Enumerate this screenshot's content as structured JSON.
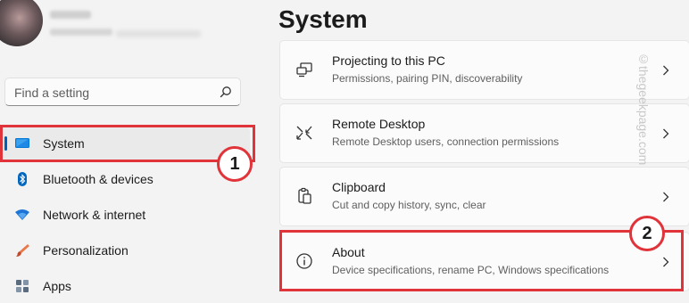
{
  "sidebar": {
    "search": {
      "placeholder": "Find a setting"
    },
    "items": [
      {
        "label": "System",
        "icon": "display-icon"
      },
      {
        "label": "Bluetooth & devices",
        "icon": "bluetooth-icon"
      },
      {
        "label": "Network & internet",
        "icon": "wifi-icon"
      },
      {
        "label": "Personalization",
        "icon": "brush-icon"
      },
      {
        "label": "Apps",
        "icon": "apps-icon"
      }
    ]
  },
  "main": {
    "title": "System",
    "cards": [
      {
        "title": "Projecting to this PC",
        "desc": "Permissions, pairing PIN, discoverability",
        "icon": "projector-icon"
      },
      {
        "title": "Remote Desktop",
        "desc": "Remote Desktop users, connection permissions",
        "icon": "remote-desktop-icon"
      },
      {
        "title": "Clipboard",
        "desc": "Cut and copy history, sync, clear",
        "icon": "clipboard-icon"
      },
      {
        "title": "About",
        "desc": "Device specifications, rename PC, Windows specifications",
        "icon": "info-icon"
      }
    ]
  },
  "annotations": {
    "step1": "1",
    "step2": "2",
    "highlight_color": "#e0343a"
  },
  "watermark": "©thegeekpage.com",
  "colors": {
    "accent": "#005fb8",
    "background": "#f3f3f3",
    "card": "#fbfbfb"
  }
}
